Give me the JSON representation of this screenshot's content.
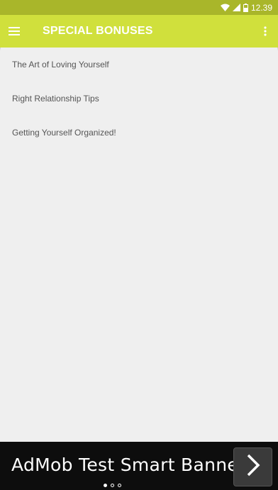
{
  "status_bar": {
    "time": "12.39",
    "icons": [
      "wifi-icon",
      "signal-icon",
      "battery-icon"
    ]
  },
  "app_bar": {
    "title": "SPECIAL BONUSES",
    "menu_icon": "hamburger-menu-icon",
    "overflow_icon": "more-vert-icon"
  },
  "list": {
    "items": [
      {
        "label": "The Art of Loving Yourself"
      },
      {
        "label": "Right Relationship Tips"
      },
      {
        "label": "Getting Yourself Organized!"
      }
    ]
  },
  "ad": {
    "text": "AdMob Test Smart Banner",
    "button_icon": "chevron-right-icon"
  },
  "colors": {
    "status_bar": "#a9b62a",
    "app_bar": "#d0e03c",
    "background": "#efefef",
    "ad_background": "#0d0d0d"
  }
}
